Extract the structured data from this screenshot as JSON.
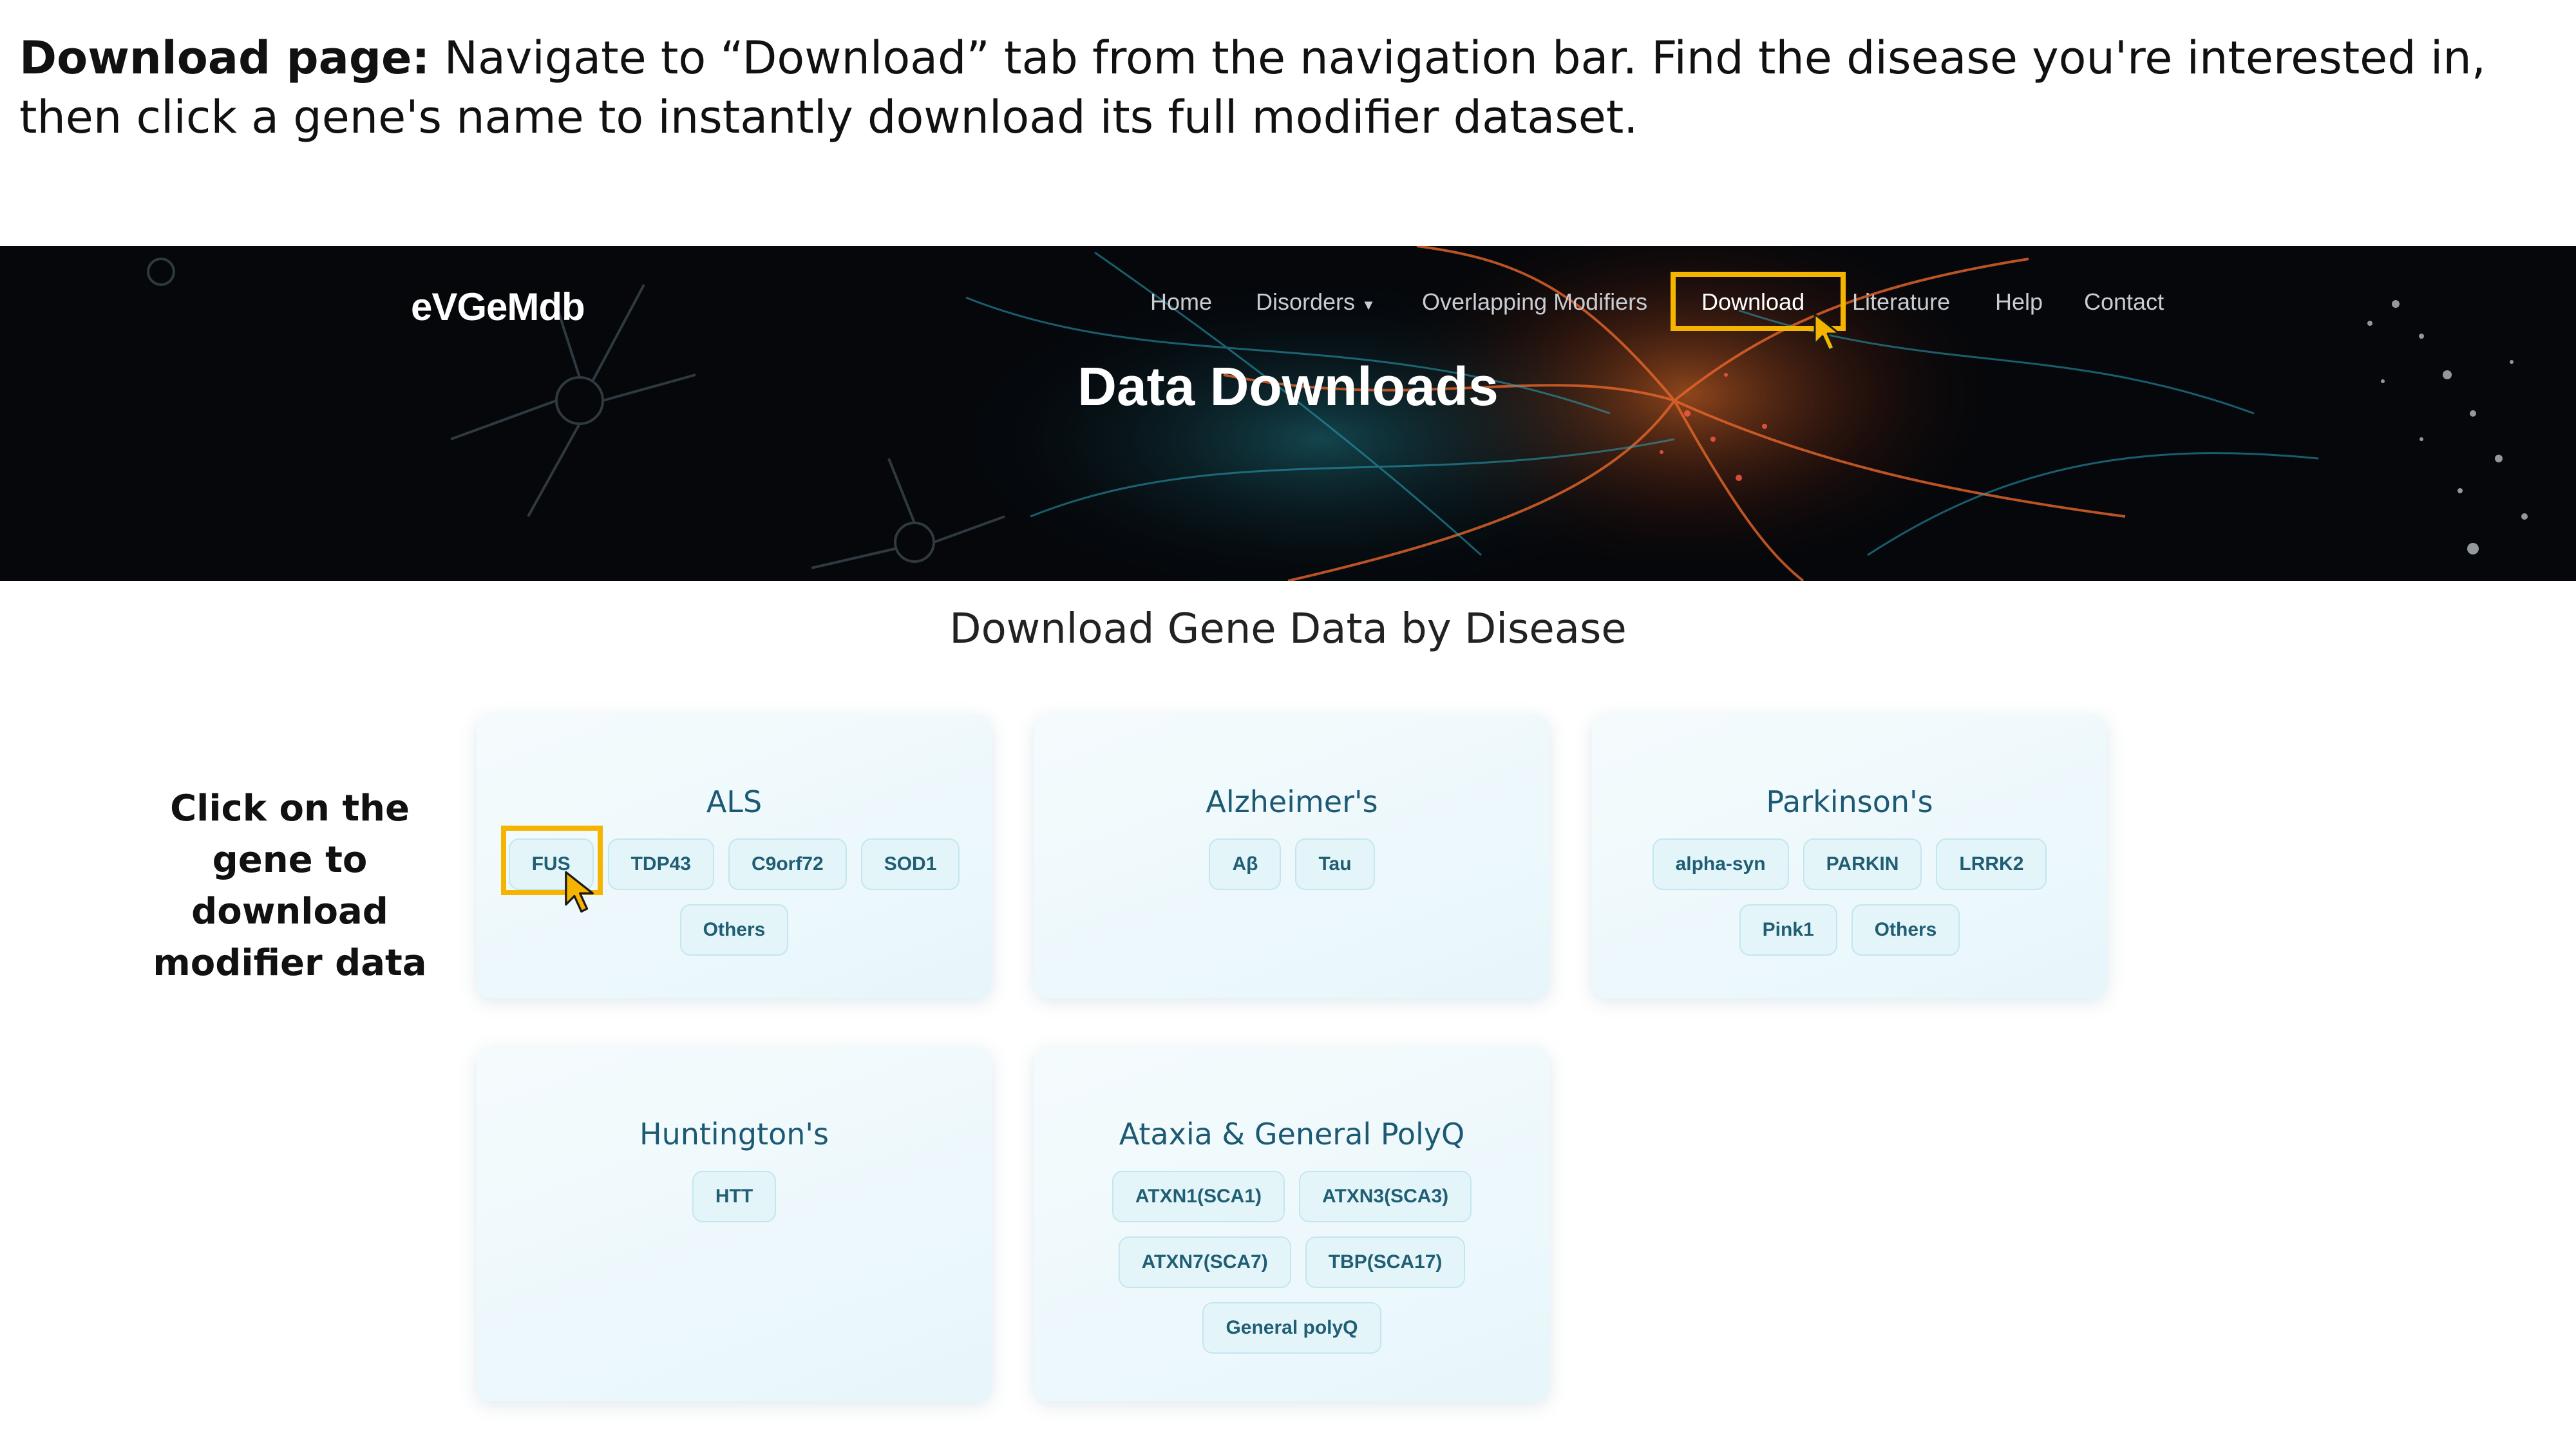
{
  "intro": {
    "lead": "Download page:",
    "text": " Navigate to “Download” tab from the navigation bar. Find the disease you're interested in, then click a gene's name to instantly download its full modifier dataset."
  },
  "site": {
    "logo": "eVGeMdb",
    "nav": [
      "Home",
      "Disorders",
      "Overlapping Modifiers",
      "Download",
      "Literature",
      "Help",
      "Contact"
    ],
    "dropdown_icon": "chevron-down-icon",
    "hero_title": "Data Downloads",
    "accent_color": "#f5b400"
  },
  "section_title": "Download Gene Data by Disease",
  "side_note": "Click on the gene to download modifier data",
  "cards": [
    {
      "title": "ALS",
      "genes": [
        "FUS",
        "TDP43",
        "C9orf72",
        "SOD1",
        "Others"
      ]
    },
    {
      "title": "Alzheimer's",
      "genes": [
        "Aβ",
        "Tau"
      ]
    },
    {
      "title": "Parkinson's",
      "genes": [
        "alpha-syn",
        "PARKIN",
        "LRRK2",
        "Pink1",
        "Others"
      ]
    },
    {
      "title": "Huntington's",
      "genes": [
        "HTT"
      ]
    },
    {
      "title": "Ataxia & General PolyQ",
      "genes": [
        "ATXN1(SCA1)",
        "ATXN3(SCA3)",
        "ATXN7(SCA7)",
        "TBP(SCA17)",
        "General polyQ"
      ]
    }
  ]
}
